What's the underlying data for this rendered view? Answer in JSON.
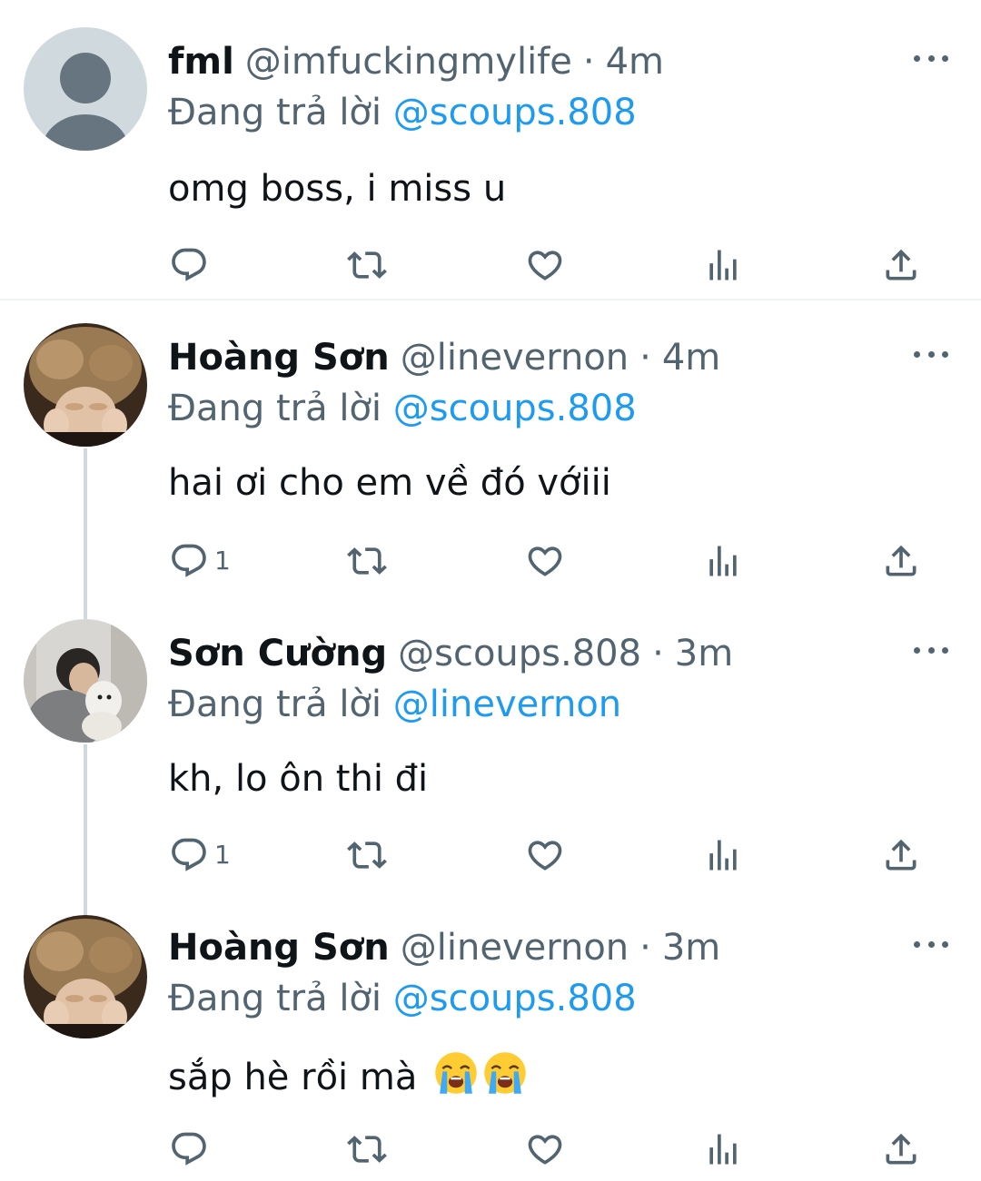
{
  "tweets": [
    {
      "name": "fml",
      "handle": "@imfuckingmylife",
      "dot": "·",
      "time": "4m",
      "replying_prefix": "Đang trả lời",
      "replying_to": "@scoups.808",
      "text": "omg boss, i miss u",
      "avatar": "default-avatar",
      "reply_count": ""
    },
    {
      "name": "Hoàng Sơn",
      "handle": "@linevernon",
      "dot": "·",
      "time": "4m",
      "replying_prefix": "Đang trả lời",
      "replying_to": "@scoups.808",
      "text": "hai ơi cho em về đó vớiii",
      "avatar": "photo-avatar-hoang-son",
      "reply_count": "1"
    },
    {
      "name": "Sơn Cường",
      "handle": "@scoups.808",
      "dot": "·",
      "time": "3m",
      "replying_prefix": "Đang trả lời",
      "replying_to": "@linevernon",
      "text": "kh, lo ôn thi đi",
      "avatar": "photo-avatar-son-cuong",
      "reply_count": "1"
    },
    {
      "name": "Hoàng Sơn",
      "handle": "@linevernon",
      "dot": "·",
      "time": "3m",
      "replying_prefix": "Đang trả lời",
      "replying_to": "@scoups.808",
      "text": "sắp hè rồi mà",
      "emoji": [
        "loudly-crying-face",
        "loudly-crying-face"
      ],
      "avatar": "photo-avatar-hoang-son",
      "reply_count": ""
    }
  ],
  "icons": [
    "reply-icon",
    "retweet-icon",
    "like-icon",
    "views-icon",
    "share-icon",
    "more-icon"
  ],
  "colors": {
    "text": "#0f1419",
    "secondary": "#536471",
    "accent": "#1d9bf0",
    "divider": "#eff3f4",
    "thread_line": "#cfd9de"
  }
}
